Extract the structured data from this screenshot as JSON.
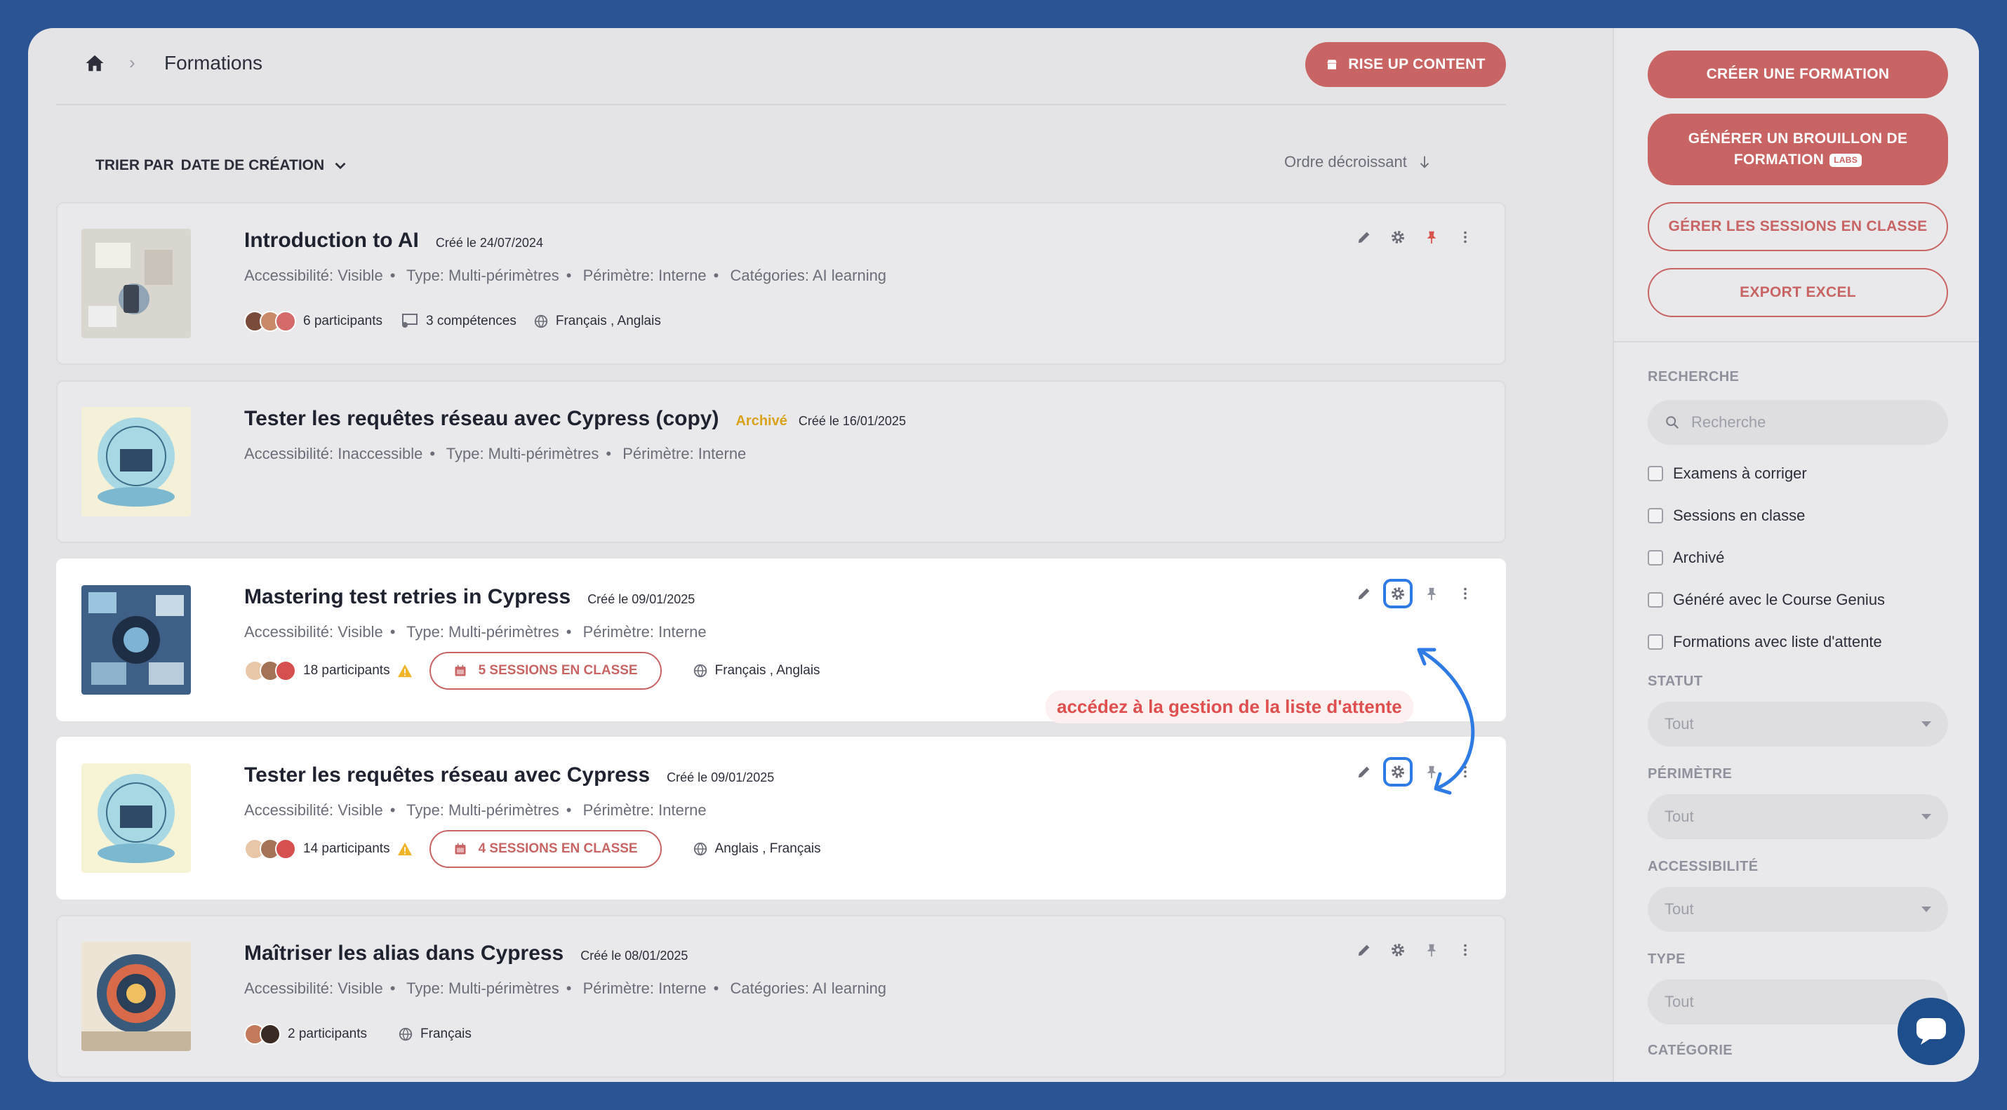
{
  "header": {
    "breadcrumb_title": "Formations",
    "rise_button": "RISE UP CONTENT"
  },
  "sort": {
    "prefix": "TRIER PAR",
    "value": "DATE DE CRÉATION",
    "order": "Ordre décroissant"
  },
  "courses": [
    {
      "title": "Introduction to AI",
      "archived": "",
      "created": "Créé le 24/07/2024",
      "accessibility": "Accessibilité: Visible",
      "type": "Type: Multi-périmètres",
      "perimeter": "Périmètre: Interne",
      "categories": "Catégories: AI learning",
      "participants": "6 participants",
      "competences": "3 compétences",
      "languages": "Français , Anglais",
      "sessions": ""
    },
    {
      "title": "Tester les requêtes réseau avec Cypress (copy)",
      "archived": "Archivé",
      "created": "Créé le 16/01/2025",
      "accessibility": "Accessibilité: Inaccessible",
      "type": "Type: Multi-périmètres",
      "perimeter": "Périmètre: Interne"
    },
    {
      "title": "Mastering test retries in Cypress",
      "created": "Créé le 09/01/2025",
      "accessibility": "Accessibilité: Visible",
      "type": "Type: Multi-périmètres",
      "perimeter": "Périmètre: Interne",
      "participants": "18 participants",
      "sessions": "5 SESSIONS EN CLASSE",
      "languages": "Français , Anglais"
    },
    {
      "title": "Tester les requêtes réseau avec Cypress",
      "created": "Créé le 09/01/2025",
      "accessibility": "Accessibilité: Visible",
      "type": "Type: Multi-périmètres",
      "perimeter": "Périmètre: Interne",
      "participants": "14 participants",
      "sessions": "4 SESSIONS EN CLASSE",
      "languages": "Anglais , Français"
    },
    {
      "title": "Maîtriser les alias dans Cypress",
      "created": "Créé le 08/01/2025",
      "accessibility": "Accessibilité: Visible",
      "type": "Type: Multi-périmètres",
      "perimeter": "Périmètre: Interne",
      "categories": "Catégories: AI learning",
      "participants": "2 participants",
      "languages": "Français"
    }
  ],
  "annotation": "accédez à la gestion de la liste d'attente",
  "sidebar": {
    "create_button": "CRÉER UNE FORMATION",
    "generate_button": "GÉNÉRER UN BROUILLON DE FORMATION",
    "labs_badge": "LABS",
    "sessions_button": "GÉRER LES SESSIONS EN CLASSE",
    "export_button": "EXPORT EXCEL",
    "search_label": "RECHERCHE",
    "search_placeholder": "Recherche",
    "checkboxes": [
      "Examens à corriger",
      "Sessions en classe",
      "Archivé",
      "Généré avec le Course Genius",
      "Formations avec liste d'attente"
    ],
    "statut_label": "STATUT",
    "statut_value": "Tout",
    "perimetre_label": "PÉRIMÈTRE",
    "perimetre_value": "Tout",
    "accessibilite_label": "ACCESSIBILITÉ",
    "accessibilite_value": "Tout",
    "type_label": "TYPE",
    "type_value": "Tout",
    "categorie_label": "CATÉGORIE"
  },
  "colors": {
    "accent": "#c86464",
    "highlight_box": "#2f7be6",
    "archived": "#d9a21b",
    "background": "#2b5494"
  },
  "icons": [
    "home-icon",
    "chevron-right-icon",
    "shop-icon",
    "chevron-down-icon",
    "arrow-down-icon",
    "pencil-icon",
    "gear-icon",
    "pin-icon",
    "more-vert-icon",
    "people-icon",
    "competence-icon",
    "globe-icon",
    "warning-icon",
    "calendar-icon",
    "search-icon",
    "chat-icon"
  ]
}
